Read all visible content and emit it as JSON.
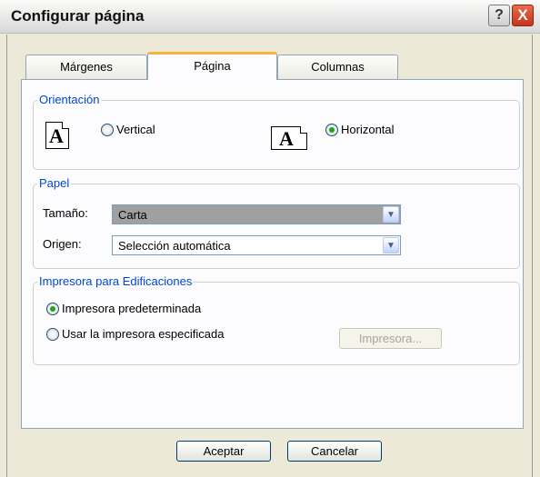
{
  "window": {
    "title": "Configurar página",
    "help_glyph": "?",
    "close_glyph": "X"
  },
  "tabs": [
    {
      "label": "Márgenes",
      "active": false
    },
    {
      "label": "Página",
      "active": true
    },
    {
      "label": "Columnas",
      "active": false
    }
  ],
  "orientation": {
    "group_label": "Orientación",
    "icon_letter": "A",
    "vertical_label": "Vertical",
    "horizontal_label": "Horizontal",
    "selected": "Horizontal"
  },
  "paper": {
    "group_label": "Papel",
    "size_label": "Tamaño:",
    "size_value": "Carta",
    "source_label": "Origen:",
    "source_value": "Selección automática"
  },
  "printer": {
    "group_label": "Impresora para Edificaciones",
    "default_label": "Impresora predeterminada",
    "specified_label": "Usar la impresora especificada",
    "selected": "Impresora predeterminada",
    "printer_button": "Impresora..."
  },
  "footer": {
    "ok_label": "Aceptar",
    "cancel_label": "Cancelar"
  },
  "colors": {
    "accent_tab": "#f2b63c",
    "group_label": "#0046d5",
    "radio_dot": "#21a121"
  }
}
